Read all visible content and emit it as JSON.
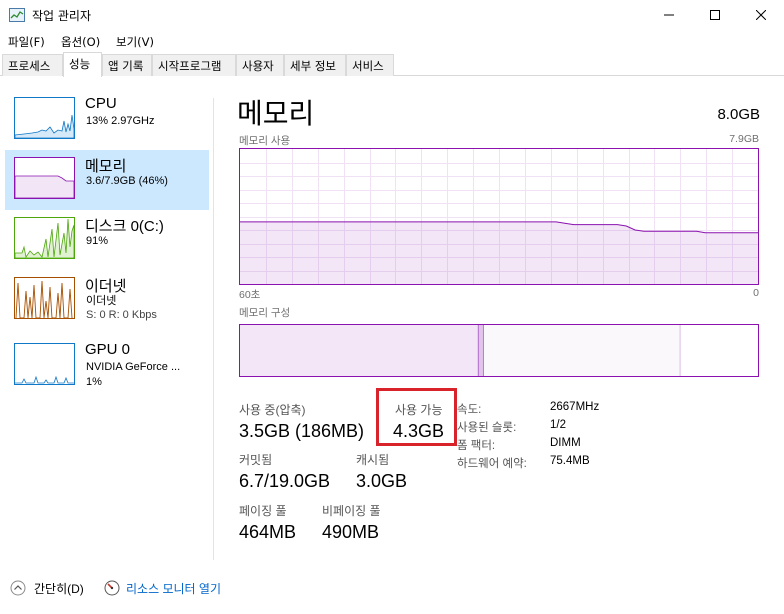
{
  "window": {
    "title": "작업 관리자"
  },
  "menu": [
    "파일(F)",
    "옵션(O)",
    "보기(V)"
  ],
  "tabs": [
    "프로세스",
    "성능",
    "앱 기록",
    "시작프로그램",
    "사용자",
    "세부 정보",
    "서비스"
  ],
  "active_tab": "성능",
  "sidebar": [
    {
      "title": "CPU",
      "sub1": "13% 2.97GHz",
      "sub2": "",
      "color": "#1178c7",
      "selected": false
    },
    {
      "title": "메모리",
      "sub1": "3.6/7.9GB (46%)",
      "sub2": "",
      "color": "#8b12ae",
      "selected": true
    },
    {
      "title": "디스크 0(C:)",
      "sub1": "91%",
      "sub2": "",
      "color": "#4da60c",
      "selected": false
    },
    {
      "title": "이더넷",
      "sub1": "이더넷",
      "sub2": "S: 0 R: 0 Kbps",
      "color": "#a74f01",
      "selected": false
    },
    {
      "title": "GPU 0",
      "sub1": "NVIDIA GeForce ...",
      "sub2": "1%",
      "color": "#1178c7",
      "selected": false
    }
  ],
  "main": {
    "title": "메모리",
    "total": "8.0GB",
    "usage_label": "메모리 사용",
    "usage_max": "7.9GB",
    "time_left": "60초",
    "time_right": "0",
    "composition_label": "메모리 구성"
  },
  "stats": {
    "in_use_label": "사용 중(압축)",
    "in_use_value": "3.5GB (186MB)",
    "available_label": "사용 가능",
    "available_value": "4.3GB",
    "committed_label": "커밋됨",
    "committed_value": "6.7/19.0GB",
    "cached_label": "캐시됨",
    "cached_value": "3.0GB",
    "paged_label": "페이징 풀",
    "paged_value": "464MB",
    "nonpaged_label": "비페이징 풀",
    "nonpaged_value": "490MB"
  },
  "props": [
    {
      "label": "속도:",
      "value": "2667MHz"
    },
    {
      "label": "사용된 슬롯:",
      "value": "1/2"
    },
    {
      "label": "폼 팩터:",
      "value": "DIMM"
    },
    {
      "label": "하드웨어 예약:",
      "value": "75.4MB"
    }
  ],
  "footer": {
    "less_details": "간단히(D)",
    "resource_monitor": "리소스 모니터 열기"
  },
  "memory_usage_series": [
    0.46,
    0.46,
    0.46,
    0.46,
    0.46,
    0.46,
    0.46,
    0.46,
    0.46,
    0.46,
    0.46,
    0.46,
    0.46,
    0.46,
    0.46,
    0.46,
    0.46,
    0.46,
    0.46,
    0.46,
    0.46,
    0.46,
    0.46,
    0.46,
    0.46,
    0.46,
    0.46,
    0.46,
    0.46,
    0.46,
    0.46,
    0.46,
    0.46,
    0.46,
    0.46,
    0.46,
    0.46,
    0.45,
    0.44,
    0.44,
    0.44,
    0.44,
    0.44,
    0.44,
    0.43,
    0.4,
    0.39,
    0.39,
    0.39,
    0.39,
    0.39,
    0.39,
    0.39,
    0.38,
    0.38,
    0.38,
    0.38,
    0.38,
    0.38,
    0.38
  ],
  "memory_composition": {
    "in_use": 0.46,
    "modified": 0.01,
    "standby": 0.38,
    "free": 0.15
  }
}
